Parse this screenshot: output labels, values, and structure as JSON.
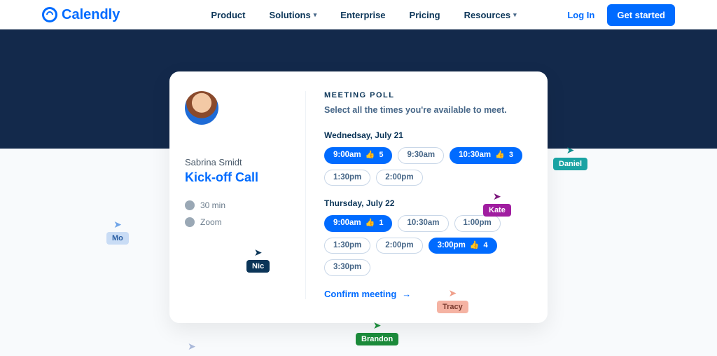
{
  "nav": {
    "brand": "Calendly",
    "links": {
      "product": "Product",
      "solutions": "Solutions",
      "enterprise": "Enterprise",
      "pricing": "Pricing",
      "resources": "Resources"
    },
    "login": "Log In",
    "cta": "Get started"
  },
  "card": {
    "host": "Sabrina Smidt",
    "title": "Kick-off Call",
    "duration": "30 min",
    "location": "Zoom",
    "poll_title": "MEETING POLL",
    "poll_sub": "Select all the times you're available to meet.",
    "confirm": "Confirm meeting",
    "days": [
      {
        "label": "Wednedsay, July 21",
        "slots": [
          {
            "time": "9:00am",
            "selected": true,
            "votes": 5
          },
          {
            "time": "9:30am",
            "selected": false
          },
          {
            "time": "10:30am",
            "selected": true,
            "votes": 3
          },
          {
            "time": "1:30pm",
            "selected": false
          },
          {
            "time": "2:00pm",
            "selected": false
          }
        ]
      },
      {
        "label": "Thursday, July 22",
        "slots": [
          {
            "time": "9:00am",
            "selected": true,
            "votes": 1
          },
          {
            "time": "10:30am",
            "selected": false
          },
          {
            "time": "1:00pm",
            "selected": false
          },
          {
            "time": "1:30pm",
            "selected": false
          },
          {
            "time": "2:00pm",
            "selected": false
          },
          {
            "time": "3:00pm",
            "selected": true,
            "votes": 4
          },
          {
            "time": "3:30pm",
            "selected": false
          }
        ]
      }
    ]
  },
  "cursors": {
    "daniel": "Daniel",
    "kate": "Kate",
    "mo": "Mo",
    "nic": "Nic",
    "tracy": "Tracy",
    "brandon": "Brandon"
  }
}
